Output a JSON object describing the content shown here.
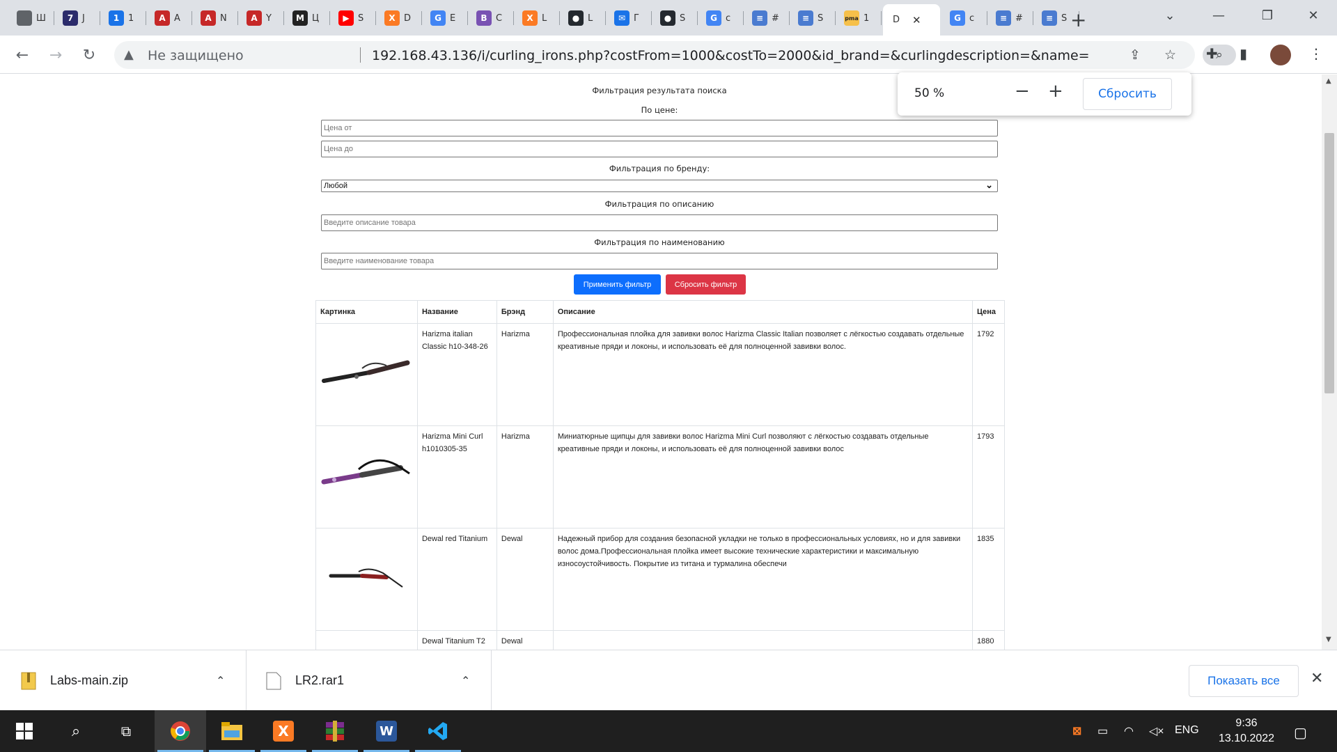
{
  "tabs": [
    {
      "letter": "",
      "color": "#5f6368",
      "title": "Ш"
    },
    {
      "letter": "7",
      "color": "#2b2b6b",
      "title": "J"
    },
    {
      "letter": "1",
      "color": "#1a73e8",
      "title": "1"
    },
    {
      "letter": "A",
      "color": "#c62828",
      "title": "A"
    },
    {
      "letter": "A",
      "color": "#c62828",
      "title": "N"
    },
    {
      "letter": "A",
      "color": "#c62828",
      "title": "Y"
    },
    {
      "letter": "M",
      "color": "#222222",
      "title": "Ц"
    },
    {
      "letter": "▶",
      "color": "#ff0000",
      "title": "S"
    },
    {
      "letter": "X",
      "color": "#fb7a24",
      "title": "D"
    },
    {
      "letter": "G",
      "color": "#4285f4",
      "title": "Е"
    },
    {
      "letter": "B",
      "color": "#7952b3",
      "title": "C"
    },
    {
      "letter": "X",
      "color": "#fb7a24",
      "title": "L"
    },
    {
      "letter": "●",
      "color": "#24292f",
      "title": "L"
    },
    {
      "letter": "✉",
      "color": "#1a73e8",
      "title": "Г"
    },
    {
      "letter": "●",
      "color": "#24292f",
      "title": "S"
    },
    {
      "letter": "G",
      "color": "#4285f4",
      "title": "c"
    },
    {
      "letter": "≡",
      "color": "#4a7bd0",
      "title": "#"
    },
    {
      "letter": "≡",
      "color": "#4a7bd0",
      "title": "S"
    },
    {
      "letter": "pma",
      "color": "#f0a030",
      "title": "1"
    }
  ],
  "active_tab": {
    "title": "D"
  },
  "tabs_after": [
    {
      "letter": "G",
      "color": "#4285f4",
      "title": "c"
    },
    {
      "letter": "≡",
      "color": "#4a7bd0",
      "title": "#"
    },
    {
      "letter": "≡",
      "color": "#4a7bd0",
      "title": "S"
    }
  ],
  "omnibox": {
    "security": "Не защищено",
    "url": "192.168.43.136/i/curling_irons.php?costFrom=1000&costTo=2000&id_brand=&curlingdescription=&name="
  },
  "zoom": {
    "level": "50 %",
    "reset": "Сбросить"
  },
  "filter": {
    "heading": "Фильтрация результата поиска",
    "price_label": "По цене:",
    "price_from_ph": "Цена от",
    "price_to_ph": "Цена до",
    "brand_label": "Фильтрация по бренду:",
    "brand_value": "Любой",
    "desc_label": "Фильтрация по описанию",
    "desc_ph": "Введите описание товара",
    "name_label": "Фильтрация по наименованию",
    "name_ph": "Введите наименование товара",
    "apply": "Применить фильтр",
    "reset": "Сбросить фильтр"
  },
  "table": {
    "headers": [
      "Картинка",
      "Название",
      "Брэнд",
      "Описание",
      "Цена"
    ],
    "rows": [
      {
        "name": "Harizma italian Classic h10-348-26",
        "brand": "Harizma",
        "desc": "Профессиональная плойка для завивки волос Harizma Classic Italian позволяет с лёгкостью создавать отдельные креативные пряди и локоны, и использовать её для полноценной завивки волос.",
        "price": "1792"
      },
      {
        "name": "Harizma Mini Curl h1010305-35",
        "brand": "Harizma",
        "desc": "Миниатюрные щипцы для завивки волос Harizma Mini Curl позволяют с лёгкостью создавать отдельные креативные пряди и локоны, и использовать её для полноценной завивки волос",
        "price": "1793"
      },
      {
        "name": "Dewal red Titanium",
        "brand": "Dewal",
        "desc": "Надежный прибор для создания безопасной укладки не только в профессиональных условиях, но и для завивки волос дома.Профессиональная плойка имеет высокие технические характеристики и максимальную износоустойчивость. Покрытие из титана и турмалина обеспечи",
        "price": "1835"
      },
      {
        "name": "Dewal Titanium T2",
        "brand": "Dewal",
        "desc": "",
        "price": "1880"
      }
    ]
  },
  "downloads": [
    {
      "name": "Labs-main.zip"
    },
    {
      "name": "LR2.rar1"
    }
  ],
  "show_all": "Показать все",
  "tray": {
    "lang": "ENG",
    "time": "9:36",
    "date": "13.10.2022"
  }
}
